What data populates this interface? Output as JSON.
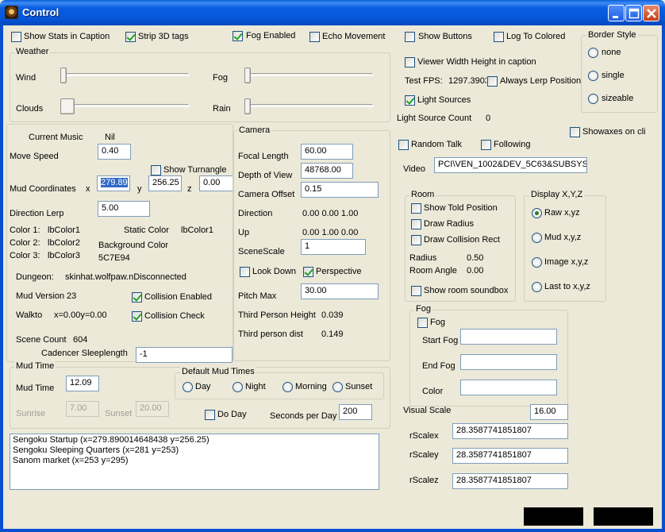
{
  "window": {
    "title": "Control"
  },
  "top_checks": {
    "show_stats": {
      "label": "Show Stats in Caption",
      "checked": false
    },
    "strip_3d": {
      "label": "Strip 3D tags",
      "checked": true
    },
    "fog_enabled": {
      "label": "Fog Enabled",
      "checked": true
    },
    "echo_movement": {
      "label": "Echo Movement",
      "checked": false
    },
    "show_buttons": {
      "label": "Show Buttons",
      "checked": false
    },
    "log_colored": {
      "label": "Log To Colored",
      "checked": false
    }
  },
  "weather": {
    "legend": "Weather",
    "wind": "Wind",
    "fog": "Fog",
    "clouds": "Clouds",
    "rain": "Rain"
  },
  "viewer": {
    "viewer_width_height": {
      "label": "Viewer Width Height in caption",
      "checked": false
    },
    "test_fps_label": "Test FPS:",
    "test_fps_value": "1297.3903",
    "always_lerp": {
      "label": "Always Lerp Position",
      "checked": false
    },
    "light_sources": {
      "label": "Light Sources",
      "checked": true
    },
    "light_source_count_label": "Light Source Count",
    "light_source_count_value": "0",
    "showaxes": {
      "label": "Showaxes on cli",
      "checked": false
    },
    "random_talk": {
      "label": "Random Talk",
      "checked": false
    },
    "following": {
      "label": "Following",
      "checked": false
    },
    "video_label": "Video",
    "video_value": "PCI\\VEN_1002&DEV_5C63&SUBSYS_"
  },
  "border_style": {
    "legend": "Border Style",
    "options": [
      {
        "label": "none",
        "checked": false
      },
      {
        "label": "single",
        "checked": false
      },
      {
        "label": "sizeable",
        "checked": false
      }
    ]
  },
  "mud": {
    "current_music_label": "Current Music",
    "current_music_value": "Nil",
    "move_speed_label": "Move Speed",
    "move_speed_value": "0.40",
    "show_turnangle": {
      "label": "Show Turnangle",
      "checked": false
    },
    "mud_coords_label": "Mud Coordinates",
    "x_label": "x",
    "x_value": "279.89",
    "y_label": "y",
    "y_value": "256.25",
    "z_label": "z",
    "z_value": "0.00",
    "direction_lerp_label": "Direction Lerp",
    "direction_lerp_value": "5.00",
    "color1_label": "Color 1:",
    "color1_value": "lbColor1",
    "color2_label": "Color 2:",
    "color2_value": "lbColor2",
    "color3_label": "Color 3:",
    "color3_value": "lbColor3",
    "static_color_label": "Static Color",
    "static_color_value": "lbColor1",
    "background_color_label": "Background Color",
    "background_color_value": "5C7E94",
    "dungeon_label": "Dungeon:",
    "dungeon_value": "skinhat.wolfpaw.nDisconnected",
    "mud_version_label": "Mud Version",
    "mud_version_value": "23",
    "collision_enabled": {
      "label": "Collision Enabled",
      "checked": true
    },
    "walkto_label": "Walkto",
    "walkto_value": "x=0.00y=0.00",
    "collision_check": {
      "label": "Collision Check",
      "checked": true
    },
    "scene_count_label": "Scene Count",
    "scene_count_value": "604",
    "cadencer_label": "Cadencer Sleeplength",
    "cadencer_value": "-1"
  },
  "camera": {
    "legend": "Camera",
    "focal_length_label": "Focal Length",
    "focal_length_value": "60.00",
    "depth_of_view_label": "Depth of View",
    "depth_of_view_value": "48768.00",
    "camera_offset_label": "Camera Offset",
    "camera_offset_value": "0.15",
    "direction_label": "Direction",
    "direction_value": "0.00 0.00 1.00",
    "up_label": "Up",
    "up_value": "0.00 1.00 0.00",
    "scene_scale_label": "SceneScale",
    "scene_scale_value": "1",
    "look_down": {
      "label": "Look Down",
      "checked": false
    },
    "perspective": {
      "label": "Perspective",
      "checked": true
    },
    "pitch_max_label": "Pitch Max",
    "pitch_max_value": "30.00",
    "third_height_label": "Third Person Height",
    "third_height_value": "0.039",
    "third_dist_label": "Third person dist",
    "third_dist_value": "0.149"
  },
  "room": {
    "legend": "Room",
    "show_told": {
      "label": "Show Told Position",
      "checked": false
    },
    "draw_radius": {
      "label": "Draw Radius",
      "checked": false
    },
    "draw_collision": {
      "label": "Draw Collision Rect",
      "checked": false
    },
    "radius_label": "Radius",
    "radius_value": "0.50",
    "room_angle_label": "Room Angle",
    "room_angle_value": "0.00",
    "show_soundbox": {
      "label": "Show room soundbox",
      "checked": false
    }
  },
  "display_xyz": {
    "legend": "Display X,Y,Z",
    "options": [
      {
        "label": "Raw x,yz",
        "checked": true
      },
      {
        "label": "Mud x,y,z",
        "checked": false
      },
      {
        "label": "Image x,y,z",
        "checked": false
      },
      {
        "label": "Last to x,y,z",
        "checked": false
      }
    ]
  },
  "fog_group": {
    "legend": "Fog",
    "fog": {
      "label": "Fog",
      "checked": false
    },
    "start_fog_label": "Start Fog",
    "start_fog_value": "",
    "end_fog_label": "End Fog",
    "end_fog_value": "",
    "color_label": "Color",
    "color_value": ""
  },
  "scale": {
    "visual_scale_label": "Visual Scale",
    "visual_scale_value": "16.00",
    "rscalex_label": "rScalex",
    "rscalex_value": "28.3587741851807",
    "rscaley_label": "rScaley",
    "rscaley_value": "28.3587741851807",
    "rscalez_label": "rScalez",
    "rscalez_value": "28.3587741851807"
  },
  "mud_time": {
    "legend": "Mud Time",
    "mud_time_label": "Mud Time",
    "mud_time_value": "12.09",
    "sunrise_label": "Sunrise",
    "sunrise_value": "7.00",
    "sunset_label": "Sunset",
    "sunset_value": "20.00",
    "default_legend": "Default Mud Times",
    "day": {
      "label": "Day",
      "checked": false
    },
    "night": {
      "label": "Night",
      "checked": false
    },
    "morning": {
      "label": "Morning",
      "checked": false
    },
    "sunset_opt": {
      "label": "Sunset",
      "checked": false
    },
    "do_day": {
      "label": "Do Day",
      "checked": false
    },
    "seconds_per_day_label": "Seconds per Day",
    "seconds_per_day_value": "200"
  },
  "locations": [
    "Sengoku Startup  (x=279.890014648438  y=256.25)",
    "Sengoku Sleeping Quarters  (x=281  y=253)",
    "Sanom market  (x=253  y=295)"
  ]
}
